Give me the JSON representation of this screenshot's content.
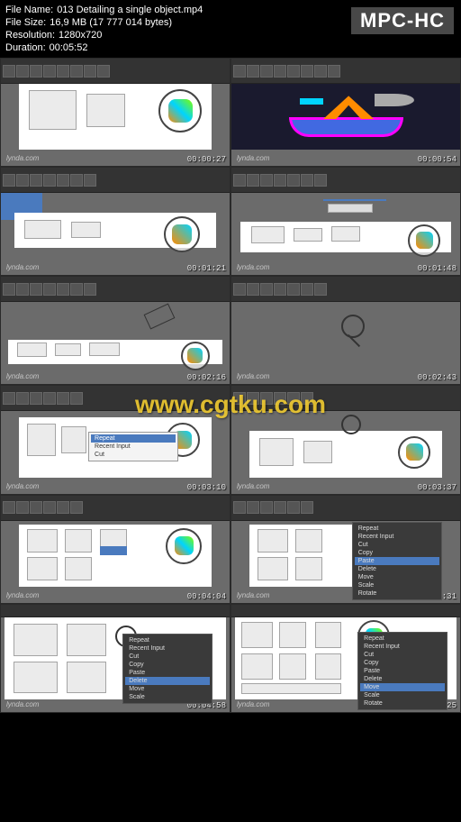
{
  "app_badge": "MPC-HC",
  "header": {
    "file_name_label": "File Name:",
    "file_name": "013 Detailing a single object.mp4",
    "file_size_label": "File Size:",
    "file_size": "16,9 MB (17 777 014 bytes)",
    "resolution_label": "Resolution:",
    "resolution": "1280x720",
    "duration_label": "Duration:",
    "duration": "00:05:52"
  },
  "watermark": "www.cgtku.com",
  "lynda_tag": "lynda.com",
  "thumbnails": [
    {
      "timecode": "00:00:27",
      "type": "light"
    },
    {
      "timecode": "00:00:54",
      "type": "dark3d"
    },
    {
      "timecode": "00:01:21",
      "type": "grayedit"
    },
    {
      "timecode": "00:01:48",
      "type": "grayedit"
    },
    {
      "timecode": "00:02:16",
      "type": "grayedit"
    },
    {
      "timecode": "00:02:43",
      "type": "graysketch"
    },
    {
      "timecode": "00:03:10",
      "type": "lightmenu"
    },
    {
      "timecode": "00:03:37",
      "type": "lightfull"
    },
    {
      "timecode": "00:04:04",
      "type": "lightfull"
    },
    {
      "timecode": "00:04:31",
      "type": "lightmenu2"
    },
    {
      "timecode": "00:04:58",
      "type": "lightfull"
    },
    {
      "timecode": "00:05:25",
      "type": "lightmenu2"
    }
  ],
  "context_menu_items": [
    "Repeat",
    "Recent Input",
    "Cut",
    "Copy",
    "Paste",
    "Delete",
    "Move",
    "Scale",
    "Rotate"
  ],
  "colors": {
    "sextant_orange": "#ff8c00",
    "sextant_magenta": "#ff00ff",
    "sextant_cyan": "#00d4ff",
    "sextant_green": "#7fff00",
    "sextant_blue": "#4169e1"
  }
}
